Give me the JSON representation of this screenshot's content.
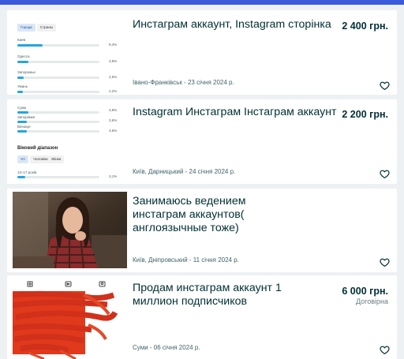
{
  "colors": {
    "accent": "#3b5bdb",
    "bar": "#23a6e0",
    "text": "#002f34",
    "meta": "#406367"
  },
  "listings": [
    {
      "title": "Инстаграм аккаунт, Instagram сторінка",
      "price": "2 400 грн.",
      "price_note": "",
      "meta": "Івано-Франківськ - 23 січня 2024 р.",
      "thumb": {
        "tabs": [
          "Города",
          "Страны"
        ],
        "stats": [
          {
            "label": "Киев",
            "pct": "9,4%",
            "value": 0.31
          },
          {
            "label": "Одесса",
            "pct": "3,8%",
            "value": 0.13
          },
          {
            "label": "Запорожье",
            "pct": "2,5%",
            "value": 0.08
          },
          {
            "label": "Умань",
            "pct": "2,2%",
            "value": 0.07
          }
        ]
      }
    },
    {
      "title": "Instagram Инстаграм Інстаграм аккаунт",
      "price": "2 200 грн.",
      "price_note": "",
      "meta": "Київ, Дарницький - 24 січня 2024 р.",
      "thumb": {
        "stats": [
          {
            "label": "Суми",
            "pct": "3,8%",
            "value": 0.13
          },
          {
            "label": "Запоріжжя",
            "pct": "3,6%",
            "value": 0.12
          },
          {
            "label": "Вінниця",
            "pct": "3,6%",
            "value": 0.12
          }
        ],
        "section_title": "Віковий діапазон",
        "tabs": [
          "Усі",
          "Чоловіки",
          "Жінки"
        ],
        "age_label": "13–17 років",
        "age_pct": "3,1%",
        "age_value": 0.1
      }
    },
    {
      "title": "Занимаюсь ведением инстаграм аккаунтов( англоязычные тоже)",
      "price": "",
      "price_note": "",
      "meta": "Київ, Дніпровський - 11 січня 2024 р."
    },
    {
      "title": "Продам инстаграм аккаунт 1 миллион подписчиков",
      "price": "6 000 грн.",
      "price_note": "Договірна",
      "meta": "Суми - 06 січня 2024 р."
    }
  ]
}
